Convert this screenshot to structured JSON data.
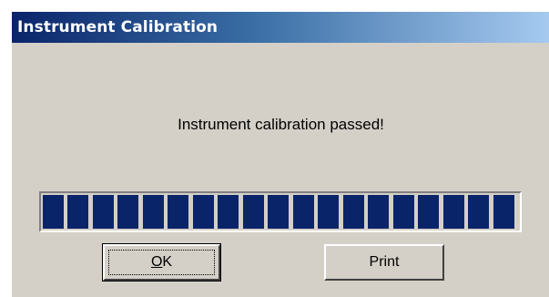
{
  "dialog": {
    "title": "Instrument Calibration",
    "message": "Instrument calibration passed!",
    "progress": {
      "fraction": 1.0,
      "segments": 19,
      "color": "#0a246a"
    },
    "buttons": {
      "ok": {
        "mnemonic": "O",
        "rest": "K"
      },
      "print": "Print"
    }
  }
}
